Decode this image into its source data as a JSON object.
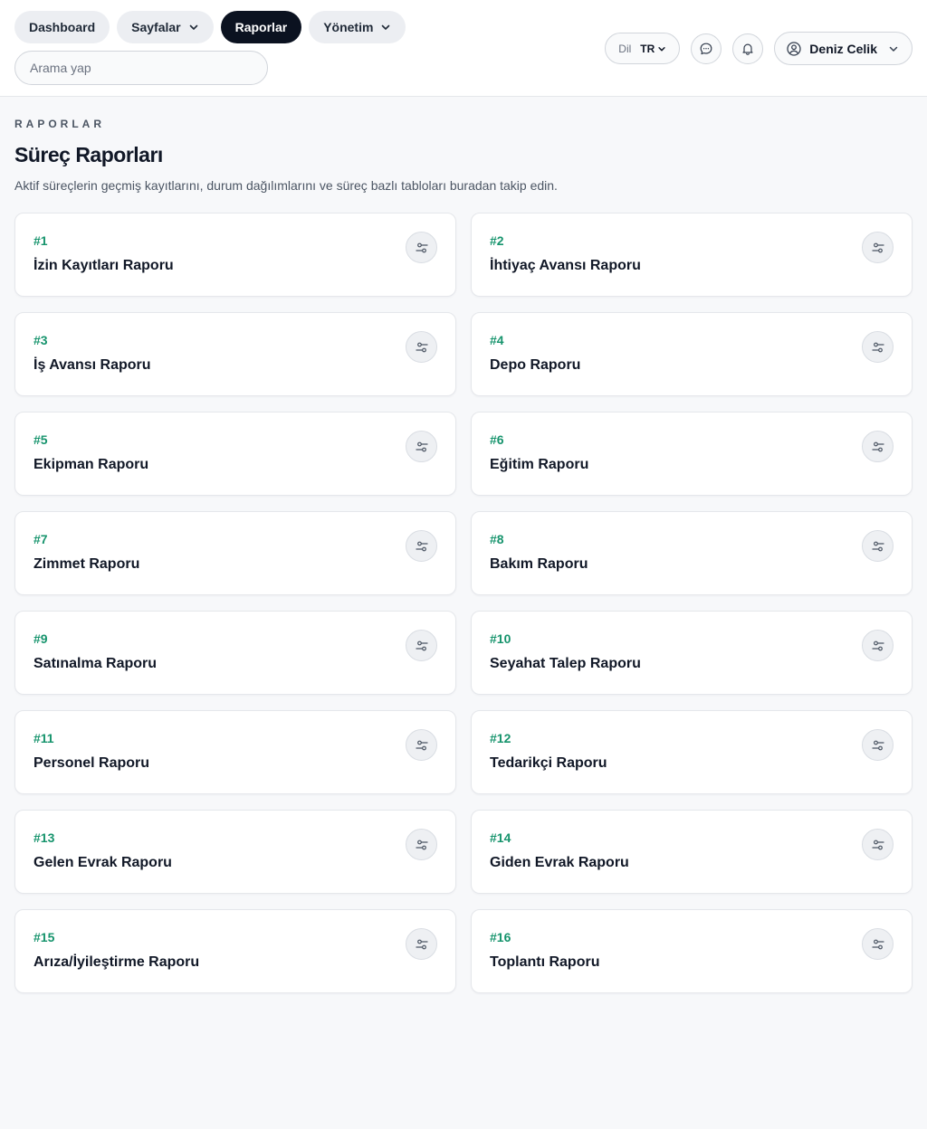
{
  "nav": {
    "items": [
      {
        "label": "Dashboard",
        "has_dropdown": false,
        "active": false
      },
      {
        "label": "Sayfalar",
        "has_dropdown": true,
        "active": false
      },
      {
        "label": "Raporlar",
        "has_dropdown": false,
        "active": true
      },
      {
        "label": "Yönetim",
        "has_dropdown": true,
        "active": false
      }
    ]
  },
  "search": {
    "placeholder": "Arama yap",
    "value": ""
  },
  "header": {
    "lang_label": "Dil",
    "lang_value": "TR",
    "user_name": "Deniz Celik"
  },
  "page": {
    "eyebrow": "RAPORLAR",
    "title": "Süreç Raporları",
    "subtitle": "Aktif süreçlerin geçmiş kayıtlarını, durum dağılımlarını ve süreç bazlı tabloları buradan takip edin."
  },
  "reports": [
    {
      "num": "#1",
      "title": "İzin Kayıtları Raporu"
    },
    {
      "num": "#2",
      "title": "İhtiyaç Avansı Raporu"
    },
    {
      "num": "#3",
      "title": "İş Avansı Raporu"
    },
    {
      "num": "#4",
      "title": "Depo Raporu"
    },
    {
      "num": "#5",
      "title": "Ekipman Raporu"
    },
    {
      "num": "#6",
      "title": "Eğitim Raporu"
    },
    {
      "num": "#7",
      "title": "Zimmet Raporu"
    },
    {
      "num": "#8",
      "title": "Bakım Raporu"
    },
    {
      "num": "#9",
      "title": "Satınalma Raporu"
    },
    {
      "num": "#10",
      "title": "Seyahat Talep Raporu"
    },
    {
      "num": "#11",
      "title": "Personel Raporu"
    },
    {
      "num": "#12",
      "title": "Tedarikçi Raporu"
    },
    {
      "num": "#13",
      "title": "Gelen Evrak Raporu"
    },
    {
      "num": "#14",
      "title": "Giden Evrak Raporu"
    },
    {
      "num": "#15",
      "title": "Arıza/İyileştirme Raporu"
    },
    {
      "num": "#16",
      "title": "Toplantı Raporu"
    }
  ],
  "icons": {
    "card_action": "sliders-icon",
    "messages": "chat-bubble-icon",
    "notifications": "bell-icon",
    "user": "user-circle-icon",
    "dropdown": "chevron-down-icon"
  },
  "colors": {
    "accent_green": "#17946d",
    "active_pill": "#0b1220"
  }
}
